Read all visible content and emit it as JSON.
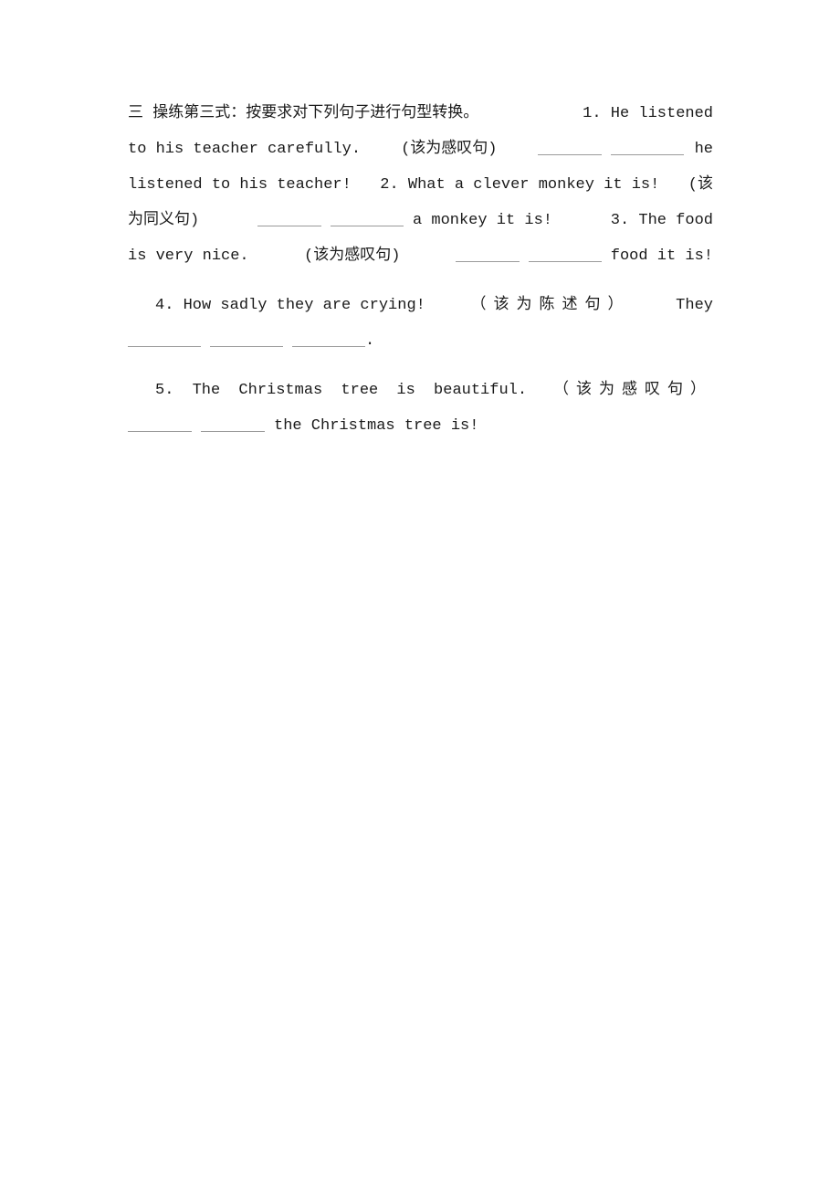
{
  "heading": "三 操练第三式：按要求对下列句子进行句型转换。",
  "items": [
    {
      "number": "1.",
      "sentence": "He listened to his teacher carefully.",
      "instruction": "(该为感叹句)",
      "answer_suffix": "he listened to his teacher!"
    },
    {
      "number": "2.",
      "sentence": "What a clever monkey it is!",
      "instruction": "(该为同义句)",
      "answer_suffix": "a monkey it is!"
    },
    {
      "number": "3.",
      "sentence": "The food is very nice.",
      "instruction": "(该为感叹句)",
      "answer_suffix": "food it is!"
    },
    {
      "number": "4.",
      "sentence": "How sadly they are crying!",
      "instruction": "（该为陈述句）",
      "answer_prefix": "They",
      "answer_end": "."
    },
    {
      "number": "5.",
      "sentence": "The Christmas tree is beautiful.",
      "instruction": "（该为感叹句）",
      "answer_suffix": "the Christmas tree is!"
    }
  ],
  "lines": {
    "l1a": "三 操练第三式：按要求对下列句子进行句型转换。",
    "l1b": "1. He listened",
    "l2a": "to his teacher carefully.",
    "l2b": "(该为感叹句)",
    "l2c": "he",
    "l3a": "listened to his teacher!",
    "l3b": "2. What a clever monkey it is!",
    "l3c": "(该",
    "l4a": "为同义句)",
    "l4b": "a monkey it is!",
    "l4c": "3. The food",
    "l5a": "is very nice.",
    "l5b": "(该为感叹句)",
    "l5c": "food it is!",
    "l6a": "4. How sadly they are crying!",
    "l6b": "（该为陈述句）",
    "l6c": "They",
    "l7end": ".",
    "l8a": "5. The Christmas tree is beautiful.",
    "l8b": "（该为感叹句）",
    "l9a": "the Christmas tree is!"
  }
}
